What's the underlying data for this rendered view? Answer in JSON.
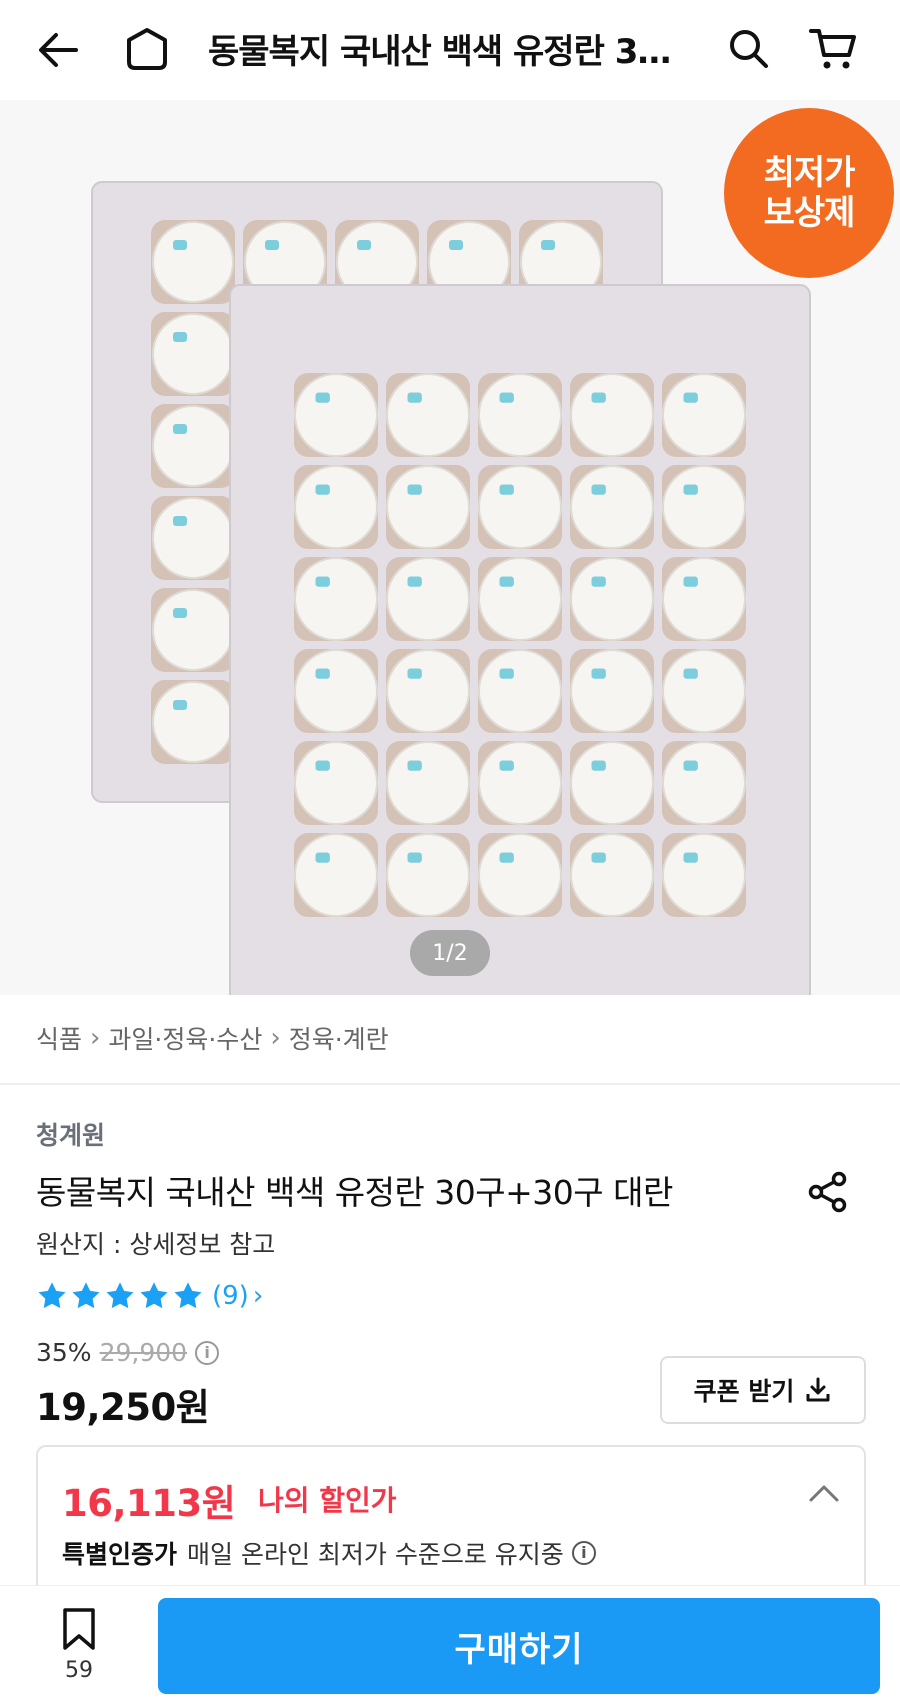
{
  "header": {
    "title": "동물복지 국내산 백색 유정란 3…",
    "icons": [
      "back-arrow-icon",
      "home-icon",
      "search-icon",
      "cart-icon"
    ]
  },
  "gallery": {
    "badge_line1": "최저가",
    "badge_line2": "보상제",
    "pager": "1/2"
  },
  "breadcrumb": {
    "items": [
      "식품",
      "과일·정육·수산",
      "정육·계란"
    ]
  },
  "product": {
    "brand": "청계원",
    "title": "동물복지 국내산 백색 유정란 30구+30구 대란",
    "origin": "원산지 : 상세정보 참고",
    "rating_count": "(9)",
    "rating_stars": 5,
    "discount_rate": "35%",
    "original_price": "29,900",
    "sale_price": "19,250원"
  },
  "coupon": {
    "label": "쿠폰 받기"
  },
  "my_discount": {
    "amount": "16,113원",
    "label": "나의 할인가",
    "cert_title": "특별인증가",
    "cert_desc": "매일 온라인 최저가 수준으로 유지중"
  },
  "bottom": {
    "wish_count": "59",
    "buy_label": "구매하기"
  },
  "colors": {
    "accent_blue": "#1a9af5",
    "discount_red": "#f0384a",
    "badge_orange": "#f26b21",
    "star_blue": "#1aa0f5"
  }
}
